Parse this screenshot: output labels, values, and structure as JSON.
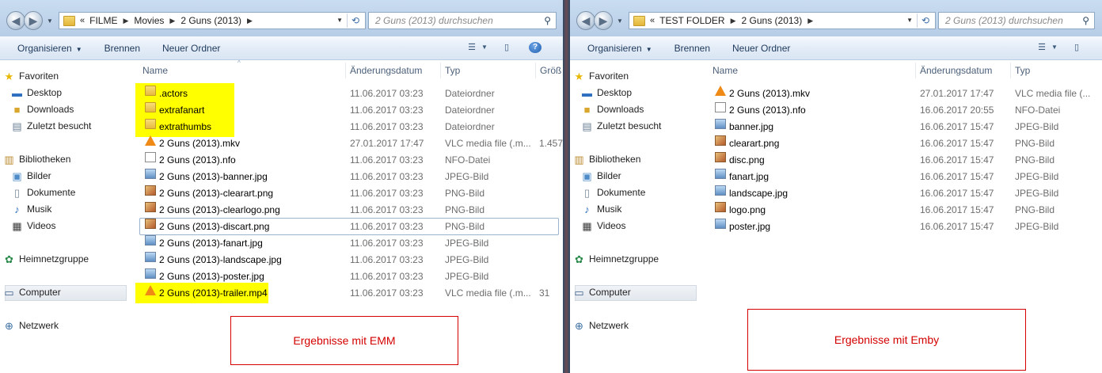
{
  "left": {
    "path": [
      "FILME",
      "Movies",
      "2 Guns (2013)"
    ],
    "search_placeholder": "2 Guns (2013) durchsuchen",
    "toolbar": {
      "organize": "Organisieren",
      "burn": "Brennen",
      "new_folder": "Neuer Ordner"
    },
    "columns": {
      "name": "Name",
      "date": "Änderungsdatum",
      "type": "Typ",
      "size": "Größ"
    },
    "rows": [
      {
        "name": ".actors",
        "date": "11.06.2017 03:23",
        "type": "Dateiordner",
        "size": "",
        "icon": "folder-icon",
        "highlight": true
      },
      {
        "name": "extrafanart",
        "date": "11.06.2017 03:23",
        "type": "Dateiordner",
        "size": "",
        "icon": "folder-icon",
        "highlight": true
      },
      {
        "name": "extrathumbs",
        "date": "11.06.2017 03:23",
        "type": "Dateiordner",
        "size": "",
        "icon": "folder-icon",
        "highlight": true
      },
      {
        "name": "2 Guns (2013).mkv",
        "date": "27.01.2017 17:47",
        "type": "VLC media file (.m...",
        "size": "1.457",
        "icon": "vlc-icon"
      },
      {
        "name": "2 Guns (2013).nfo",
        "date": "11.06.2017 03:23",
        "type": "NFO-Datei",
        "size": "",
        "icon": "nfo-icon"
      },
      {
        "name": "2 Guns (2013)-banner.jpg",
        "date": "11.06.2017 03:23",
        "type": "JPEG-Bild",
        "size": "",
        "icon": "jpeg-icon"
      },
      {
        "name": "2 Guns (2013)-clearart.png",
        "date": "11.06.2017 03:23",
        "type": "PNG-Bild",
        "size": "",
        "icon": "png-icon"
      },
      {
        "name": "2 Guns (2013)-clearlogo.png",
        "date": "11.06.2017 03:23",
        "type": "PNG-Bild",
        "size": "",
        "icon": "png-icon"
      },
      {
        "name": "2 Guns (2013)-discart.png",
        "date": "11.06.2017 03:23",
        "type": "PNG-Bild",
        "size": "",
        "icon": "png-icon",
        "selected": true
      },
      {
        "name": "2 Guns (2013)-fanart.jpg",
        "date": "11.06.2017 03:23",
        "type": "JPEG-Bild",
        "size": "",
        "icon": "jpeg-icon"
      },
      {
        "name": "2 Guns (2013)-landscape.jpg",
        "date": "11.06.2017 03:23",
        "type": "JPEG-Bild",
        "size": "",
        "icon": "jpeg-icon"
      },
      {
        "name": "2 Guns (2013)-poster.jpg",
        "date": "11.06.2017 03:23",
        "type": "JPEG-Bild",
        "size": "",
        "icon": "jpeg-icon"
      },
      {
        "name": "2 Guns (2013)-trailer.mp4",
        "date": "11.06.2017 03:23",
        "type": "VLC media file (.m...",
        "size": "31",
        "icon": "vlc-icon",
        "highlight": true
      }
    ],
    "annotation": "Ergebnisse mit EMM"
  },
  "right": {
    "path": [
      "TEST FOLDER",
      "2 Guns (2013)"
    ],
    "search_placeholder": "2 Guns (2013) durchsuchen",
    "toolbar": {
      "organize": "Organisieren",
      "burn": "Brennen",
      "new_folder": "Neuer Ordner"
    },
    "columns": {
      "name": "Name",
      "date": "Änderungsdatum",
      "type": "Typ"
    },
    "rows": [
      {
        "name": "2 Guns (2013).mkv",
        "date": "27.01.2017 17:47",
        "type": "VLC media file (...",
        "icon": "vlc-icon"
      },
      {
        "name": "2 Guns (2013).nfo",
        "date": "16.06.2017 20:55",
        "type": "NFO-Datei",
        "icon": "nfo-icon"
      },
      {
        "name": "banner.jpg",
        "date": "16.06.2017 15:47",
        "type": "JPEG-Bild",
        "icon": "jpeg-icon"
      },
      {
        "name": "clearart.png",
        "date": "16.06.2017 15:47",
        "type": "PNG-Bild",
        "icon": "png-icon"
      },
      {
        "name": "disc.png",
        "date": "16.06.2017 15:47",
        "type": "PNG-Bild",
        "icon": "png-icon"
      },
      {
        "name": "fanart.jpg",
        "date": "16.06.2017 15:47",
        "type": "JPEG-Bild",
        "icon": "jpeg-icon"
      },
      {
        "name": "landscape.jpg",
        "date": "16.06.2017 15:47",
        "type": "JPEG-Bild",
        "icon": "jpeg-icon"
      },
      {
        "name": "logo.png",
        "date": "16.06.2017 15:47",
        "type": "PNG-Bild",
        "icon": "png-icon"
      },
      {
        "name": "poster.jpg",
        "date": "16.06.2017 15:47",
        "type": "JPEG-Bild",
        "icon": "jpeg-icon"
      }
    ],
    "annotation": "Ergebnisse mit Emby"
  },
  "sidebar": {
    "favorites": "Favoriten",
    "desktop": "Desktop",
    "downloads": "Downloads",
    "recent": "Zuletzt besucht",
    "libraries": "Bibliotheken",
    "pictures": "Bilder",
    "documents": "Dokumente",
    "music": "Musik",
    "videos": "Videos",
    "homegroup": "Heimnetzgruppe",
    "computer": "Computer",
    "network": "Netzwerk"
  },
  "colors": {
    "highlight": "#ffff00",
    "annotation": "#d40000"
  }
}
